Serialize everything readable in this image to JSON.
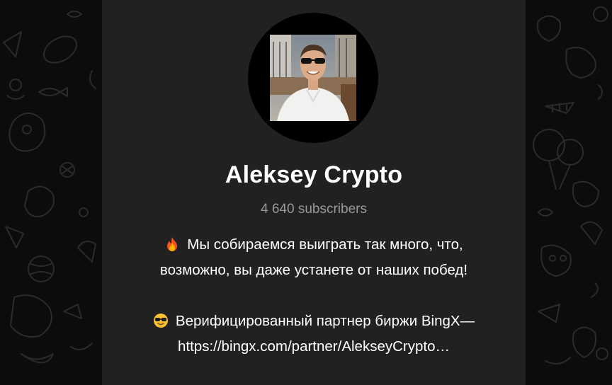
{
  "channel": {
    "name": "Aleksey Crypto",
    "subscribers": "4 640 subscribers"
  },
  "description": {
    "line1": "Мы собираемся выиграть так много, что,",
    "line2": "возможно, вы даже устанете от наших побед!",
    "line3": "Верифицированный партнер биржи BingX—",
    "line4": "https://bingx.com/partner/AlekseyCrypto…",
    "emoji1": "fire-emoji",
    "emoji2": "sunglasses-face-emoji"
  },
  "colors": {
    "background": "#0c0c0c",
    "card": "#212121",
    "text": "#ffffff",
    "muted": "#9a9a9a"
  }
}
